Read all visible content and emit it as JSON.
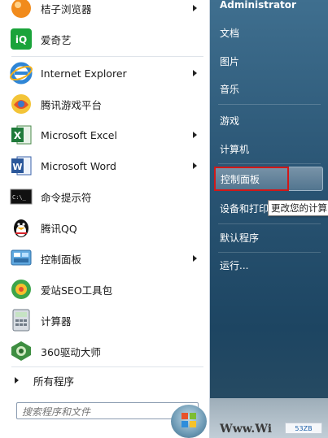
{
  "programs": [
    {
      "label": "桔子浏览器",
      "icon": "orange-browser-icon",
      "has_submenu": true
    },
    {
      "label": "爱奇艺",
      "icon": "iqiyi-icon",
      "has_submenu": false
    },
    {
      "label": "Internet Explorer",
      "icon": "internet-explorer-icon",
      "has_submenu": true
    },
    {
      "label": "腾讯游戏平台",
      "icon": "tencent-games-icon",
      "has_submenu": false
    },
    {
      "label": "Microsoft Excel",
      "icon": "excel-icon",
      "has_submenu": true
    },
    {
      "label": "Microsoft Word",
      "icon": "word-icon",
      "has_submenu": true
    },
    {
      "label": "命令提示符",
      "icon": "command-prompt-icon",
      "has_submenu": false
    },
    {
      "label": "腾讯QQ",
      "icon": "qq-penguin-icon",
      "has_submenu": false
    },
    {
      "label": "控制面板",
      "icon": "control-panel-icon",
      "has_submenu": true
    },
    {
      "label": "爱站SEO工具包",
      "icon": "aizhan-seo-icon",
      "has_submenu": false
    },
    {
      "label": "计算器",
      "icon": "calculator-icon",
      "has_submenu": false
    },
    {
      "label": "360驱动大师",
      "icon": "driver-master-icon",
      "has_submenu": false
    }
  ],
  "all_programs_label": "所有程序",
  "search": {
    "placeholder": "搜索程序和文件"
  },
  "cmd_icon_text": "C:\\_",
  "right_pane": {
    "user": "Administrator",
    "documents": "文档",
    "pictures": "图片",
    "music": "音乐",
    "games": "游戏",
    "computer": "计算机",
    "control_panel": "控制面板",
    "devices_printers": "设备和打印",
    "default_programs": "默认程序",
    "run": "运行..."
  },
  "tooltip": "更改您的计算",
  "watermark": {
    "site": "Www.Wi",
    "badge": "53ZB"
  },
  "colors": {
    "accent_blue": "#2a5574",
    "highlight_red": "#d01818"
  }
}
